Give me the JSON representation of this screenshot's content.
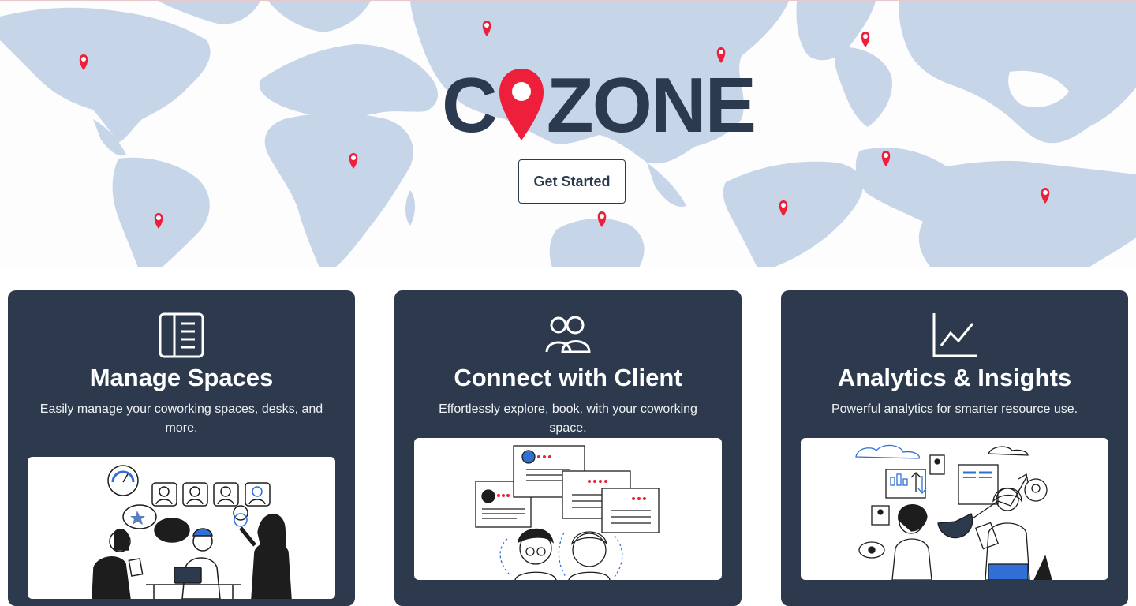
{
  "hero": {
    "brand": {
      "left_text": "C",
      "right_text": "ZONE",
      "pin_icon": "location-pin-icon",
      "text_color": "#2b3a4f",
      "pin_color": "#ee1f3b"
    },
    "get_started_label": "Get Started",
    "map_color": "#c6d5e8",
    "marker_icon": "location-pin-icon"
  },
  "cards": [
    {
      "icon": "document-list-icon",
      "title": "Manage Spaces",
      "description": "Easily manage your coworking spaces, desks, and more."
    },
    {
      "icon": "users-icon",
      "title": "Connect with Client",
      "description": "Effortlessly explore, book, with your coworking space."
    },
    {
      "icon": "line-chart-icon",
      "title": "Analytics & Insights",
      "description": "Powerful analytics for smarter resource use."
    }
  ],
  "colors": {
    "card_background": "#2d3a4d",
    "accent_red": "#ee1f3b",
    "accent_blue": "#2f6fd6"
  }
}
